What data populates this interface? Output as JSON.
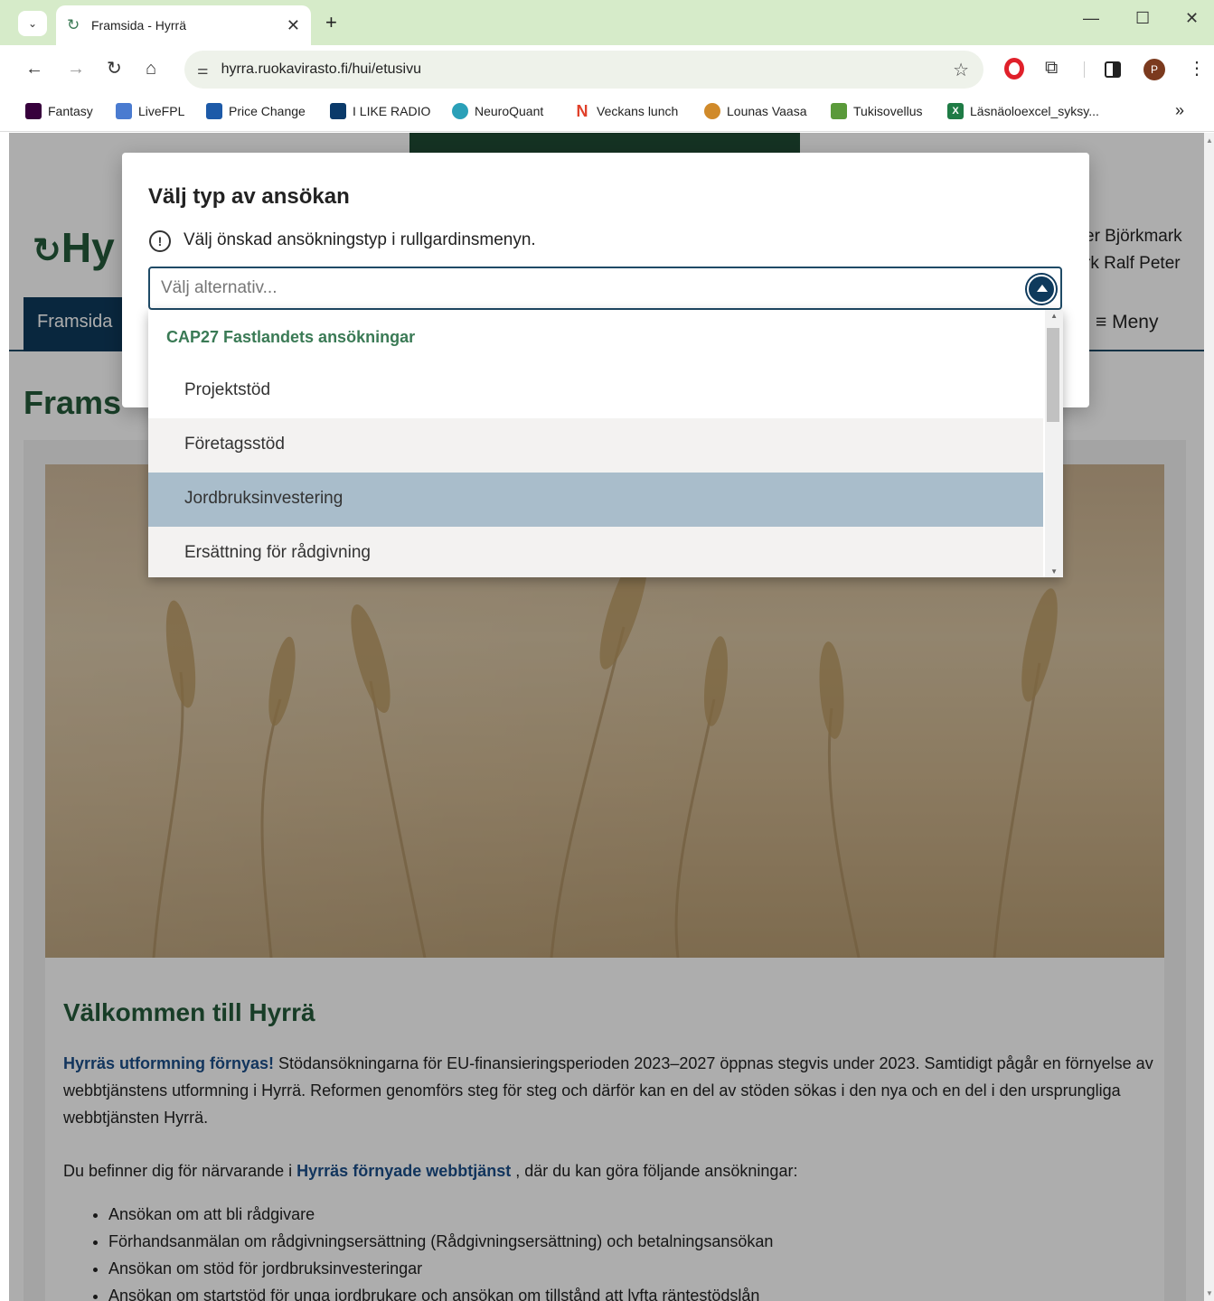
{
  "browser": {
    "tab_title": "Framsida - Hyrrä",
    "url": "hyrra.ruokavirasto.fi/hui/etusivu",
    "profile_initial": "P",
    "bookmarks": [
      {
        "label": "Fantasy",
        "color": "#37003c"
      },
      {
        "label": "LiveFPL",
        "color": "#4a7bd0"
      },
      {
        "label": "Price Change",
        "color": "#1d5aa8"
      },
      {
        "label": "I LIKE RADIO",
        "color": "#0a3a6a"
      },
      {
        "label": "NeuroQuant",
        "color": "#2aa0b8"
      },
      {
        "label": "Veckans lunch",
        "color": "#e0402a"
      },
      {
        "label": "Lounas Vaasa",
        "color": "#d08a2a"
      },
      {
        "label": "Tukisovellus",
        "color": "#5a9a3a"
      },
      {
        "label": "Läsnäoloexcel_syksy...",
        "color": "#1e7b45"
      }
    ]
  },
  "header": {
    "logo_text": "Hy",
    "user_line1": "er Björkmark",
    "user_line2": "rk Ralf Peter",
    "nav_home": "Framsida",
    "nav_menu": "≡  Meny",
    "page_title": "Frams"
  },
  "modal": {
    "title": "Välj typ av ansökan",
    "info": "Välj önskad ansökningstyp i rullgardinsmenyn.",
    "select_placeholder": "Välj alternativ..."
  },
  "dropdown": {
    "group": "CAP27 Fastlandets ansökningar",
    "items": [
      "Projektstöd",
      "Företagsstöd",
      "Jordbruksinvestering",
      "Ersättning för rådgivning"
    ],
    "highlighted_index": 2
  },
  "content": {
    "welcome": "Välkommen till Hyrrä",
    "para1_bold": "Hyrräs utformning förnyas!",
    "para1_rest": " Stödansökningarna för EU-finansieringsperioden 2023–2027 öppnas stegvis under 2023. Samtidigt pågår en förnyelse av webbtjänstens utformning i Hyrrä. Reformen genomförs steg för steg och därför kan en del av stöden sökas i den nya och en del i den ursprungliga webbtjänsten Hyrrä.",
    "para2_pre": "Du befinner dig för närvarande i ",
    "para2_bold": "Hyrräs förnyade webbtjänst",
    "para2_post": " , där du kan göra följande ansökningar:",
    "list": [
      "Ansökan om att bli rådgivare",
      "Förhandsanmälan om rådgivningsersättning (Rådgivningsersättning) och betalningsansökan",
      "Ansökan om stöd för jordbruksinvesteringar",
      "Ansökan om startstöd för unga jordbrukare och ansökan om tillstånd att lyfta räntestödslån"
    ]
  }
}
